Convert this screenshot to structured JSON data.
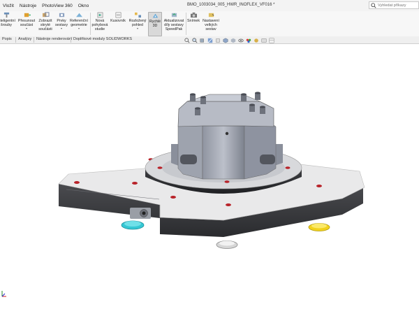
{
  "menu": [
    "Vložit",
    "Nástroje",
    "PhotoView 360",
    "Okno"
  ],
  "document_title": "BMO_1003034_005_HWR_INOFLEX_VF016 *",
  "search": {
    "placeholder": "Vyhledat příkazy"
  },
  "ribbon": [
    {
      "label": "Inteligentní\nšrouby",
      "icon": "smart-fasteners-icon"
    },
    {
      "label": "Přesunout\nsoučást",
      "icon": "move-component-icon",
      "dropdown": true
    },
    {
      "label": "Zobrazit\nskryté\nsoučásti",
      "icon": "show-hidden-icon"
    },
    {
      "label": "Prvky\nsestavy",
      "icon": "assembly-features-icon",
      "dropdown": true
    },
    {
      "label": "Referenční\ngeometrie",
      "icon": "reference-geometry-icon",
      "dropdown": true
    },
    {
      "label": "Nová\npohybová\nstudie",
      "icon": "motion-study-icon"
    },
    {
      "label": "Kusovník",
      "icon": "bom-icon"
    },
    {
      "label": "Rozložený\npohled",
      "icon": "exploded-view-icon",
      "dropdown": true
    },
    {
      "label": "Rychlé\n3D",
      "icon": "instant3d-icon"
    },
    {
      "label": "Aktualizovat\ndíly sestavy\nSpeedPak",
      "icon": "speedpak-icon"
    },
    {
      "label": "Snímek",
      "icon": "snapshot-icon"
    },
    {
      "label": "Nastavení\nvelkých\nsestav",
      "icon": "large-assembly-icon"
    }
  ],
  "tabs": [
    "Popis",
    "Analýzy",
    "Nástroje renderování",
    "Doplňkové moduly SOLIDWORKS"
  ],
  "heads_up_toolbar": [
    "zoom-to-fit-icon",
    "zoom-area-icon",
    "previous-view-icon",
    "section-view-icon",
    "dynamic-annotation-icon",
    "view-orientation-icon",
    "display-style-icon",
    "hide-show-icon",
    "edit-appearance-icon",
    "apply-scene-icon",
    "view-settings-icon",
    "display-pane-icon"
  ],
  "colors": {
    "plate": "#3c3d40",
    "plate_top": "#e6e6e6",
    "fixture_body": "#a9adb8",
    "hole_red": "#b8232a",
    "foot_cyan": "#35c7d4",
    "foot_yellow": "#f2d21d",
    "active_button": "#d9d9d9"
  }
}
